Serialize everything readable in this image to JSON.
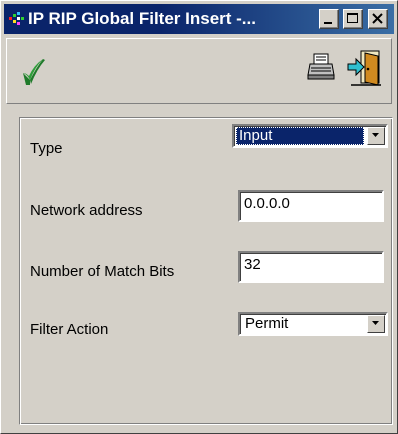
{
  "window": {
    "title": "IP RIP Global Filter Insert -...",
    "title_icon": "network-app-icon",
    "controls": {
      "minimize_icon": "minimize-icon",
      "maximize_icon": "maximize-icon",
      "close_icon": "close-icon"
    }
  },
  "toolbar": {
    "apply_icon": "checkmark-icon",
    "print_icon": "printer-icon",
    "exit_icon": "exit-door-icon"
  },
  "form": {
    "type": {
      "label": "Type",
      "value": "Input"
    },
    "network_address": {
      "label": "Network address",
      "value": "0.0.0.0"
    },
    "match_bits": {
      "label": "Number of Match Bits",
      "value": "32"
    },
    "filter_action": {
      "label": "Filter Action",
      "value": "Permit"
    }
  },
  "colors": {
    "titlebar": "#0a246a",
    "face": "#d4d0c8",
    "check_green": "#2e9e3a",
    "selection": "#0a246a"
  }
}
